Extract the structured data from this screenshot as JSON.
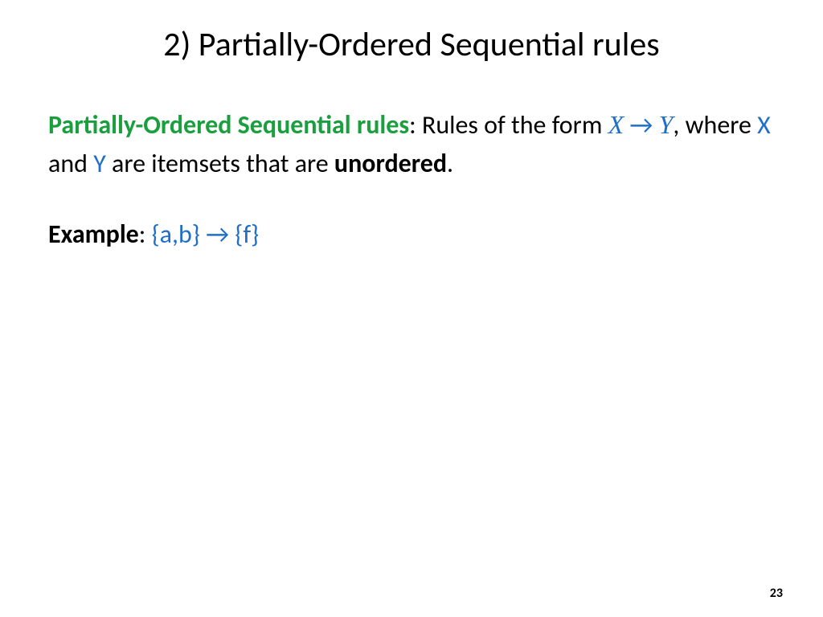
{
  "title": "2) Partially-Ordered Sequential rules",
  "definition": {
    "term": "Partially-Ordered Sequential rules",
    "text_before_formula": ": Rules of the form ",
    "formula_x": "X",
    "formula_arrow": " → ",
    "formula_y": "Y",
    "text_after_formula": ", where ",
    "x_label": "X",
    "middle_text": " and ",
    "y_label": "Y",
    "end_text": " are itemsets that are ",
    "unordered": "unordered",
    "period": "."
  },
  "example": {
    "label": "Example",
    "colon": ":  ",
    "expression": "{a,b} → {f}"
  },
  "page_number": "23"
}
